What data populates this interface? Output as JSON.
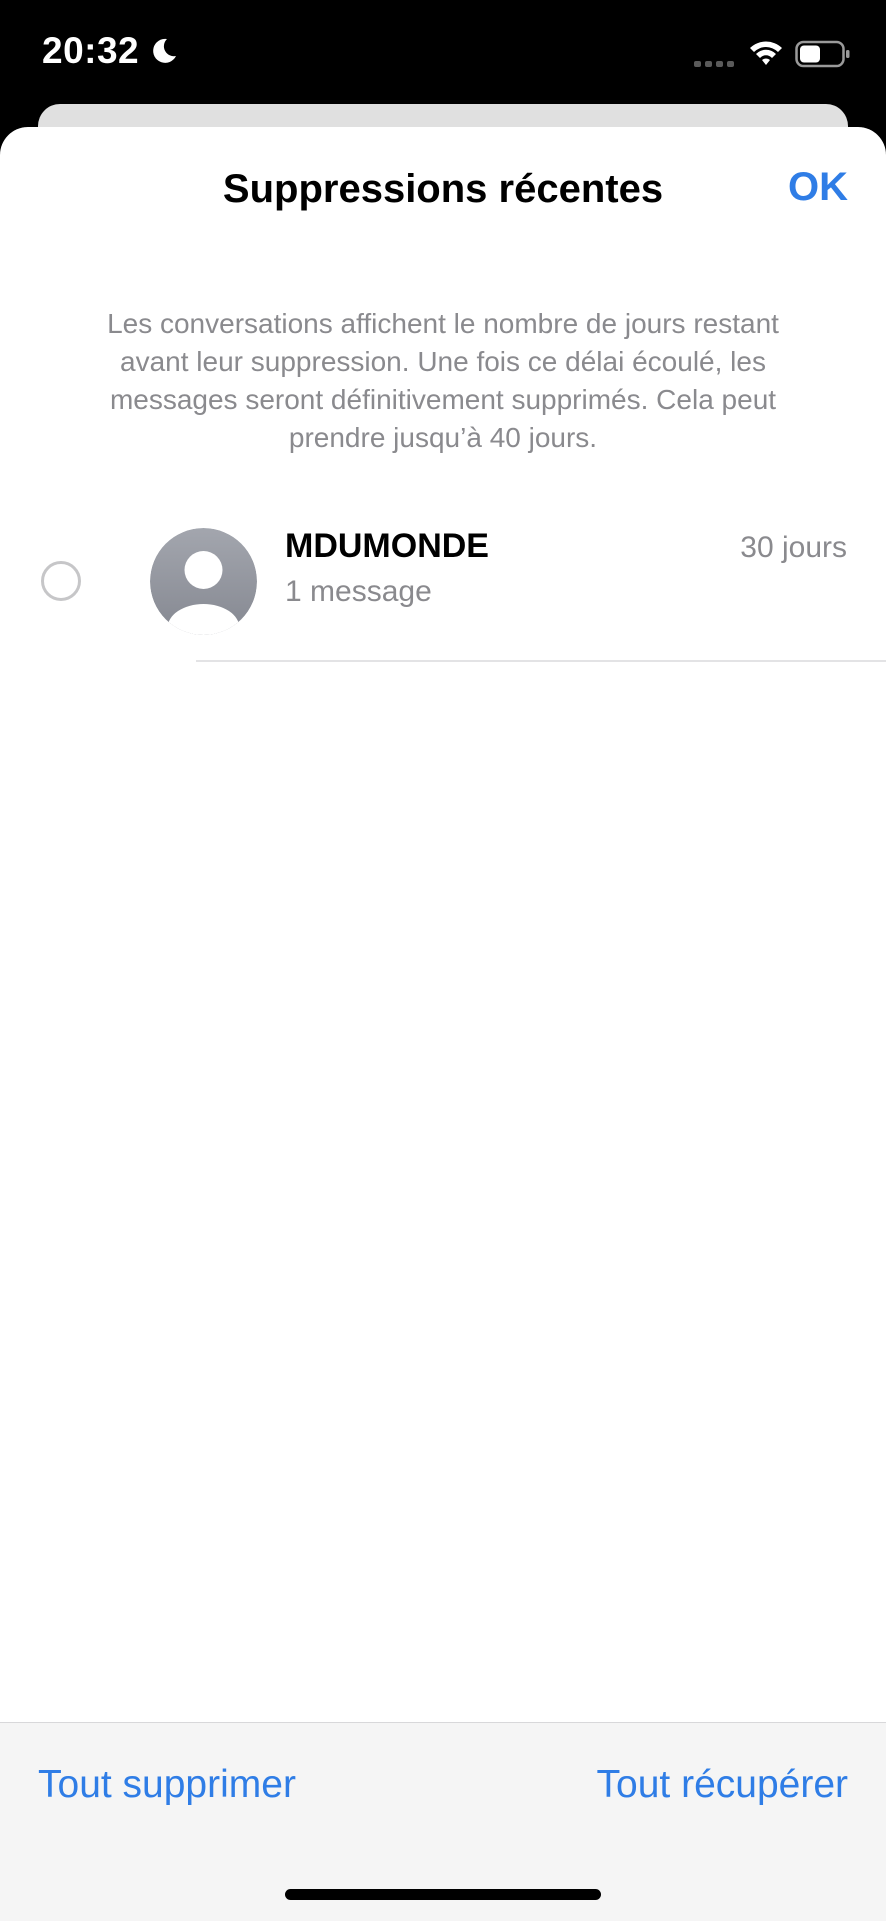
{
  "status_bar": {
    "time": "20:32"
  },
  "sheet": {
    "title": "Suppressions récentes",
    "done_label": "OK",
    "info": "Les conversations affichent le nombre de jours restant avant leur suppression. Une fois ce délai écoulé, les messages seront définitivement supprimés. Cela peut prendre jusqu’à 40 jours."
  },
  "conversations": [
    {
      "name": "MDUMONDE",
      "subtitle": "1 message",
      "days_left": "30 jours"
    }
  ],
  "toolbar": {
    "delete_all_label": "Tout supprimer",
    "recover_all_label": "Tout récupérer"
  },
  "colors": {
    "accent": "#2f7de6",
    "secondary_text": "#8a8a8e",
    "avatar_gradient_top": "#a3a6ae",
    "avatar_gradient_bottom": "#858891"
  },
  "icons": {
    "status_moon": "moon-icon",
    "signal": "signal-icon",
    "wifi": "wifi-icon",
    "battery": "battery-icon",
    "avatar_placeholder": "person-icon"
  }
}
